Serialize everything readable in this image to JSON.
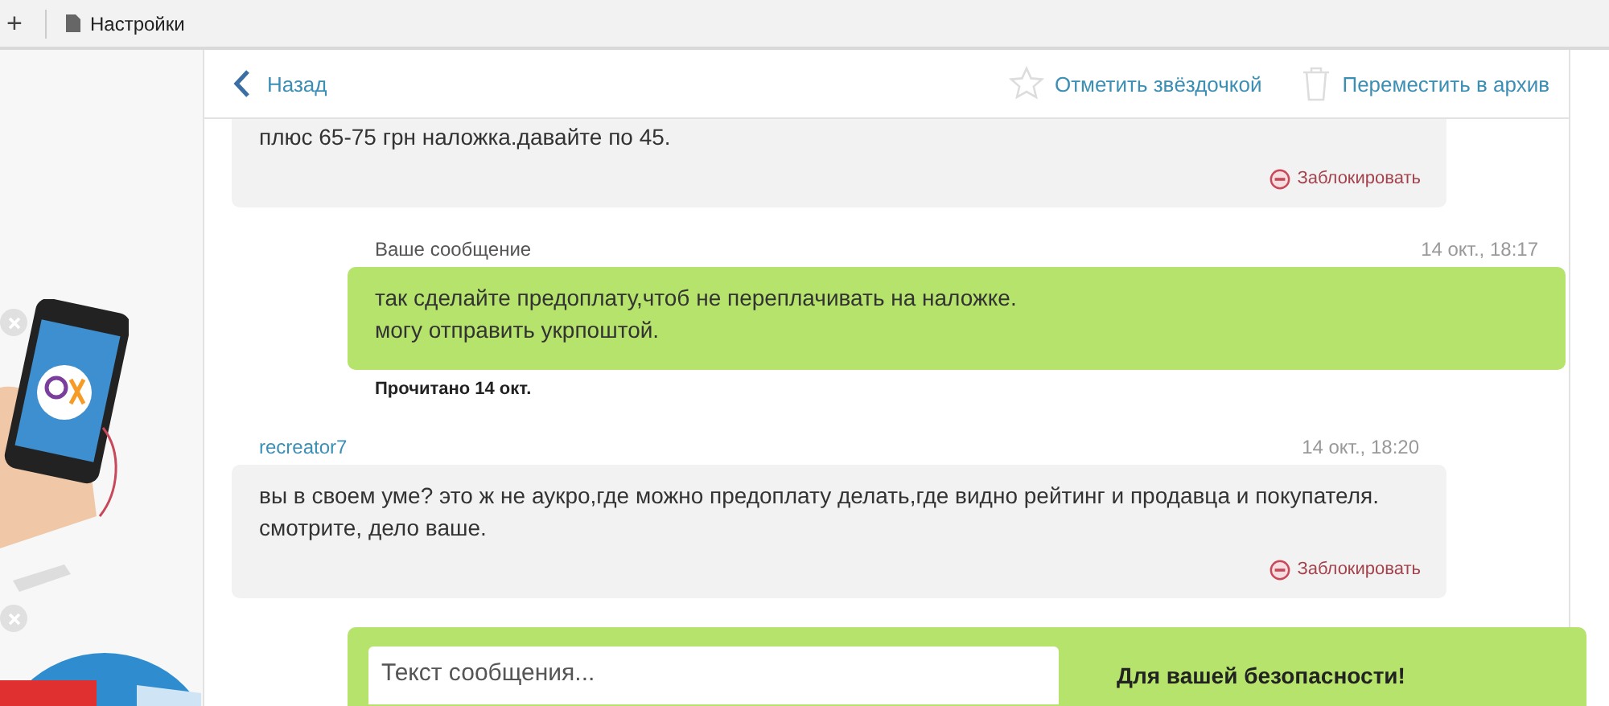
{
  "browser_bar": {
    "new_tab": "+",
    "bookmark": "Настройки"
  },
  "header": {
    "back": "Назад",
    "actions": [
      {
        "kind": "star",
        "label": "Отметить звёздочкой"
      },
      {
        "kind": "archive",
        "label": "Переместить в архив"
      }
    ]
  },
  "messages": [
    {
      "kind": "incoming",
      "lines": [
        "плюс 65-75 грн наложка.давайте по 45."
      ],
      "block": "Заблокировать"
    },
    {
      "kind": "outgoing",
      "author": "Ваше сообщение",
      "time": "14 окт., 18:17",
      "lines": [
        "так сделайте предоплату,чтоб не переплачивать на наложке.",
        "могу отправить укрпоштой."
      ],
      "status": "Прочитано 14 окт."
    },
    {
      "kind": "incoming",
      "author": "recreator7",
      "time": "14 окт., 18:20",
      "lines": [
        "вы в своем уме? это ж не аукро,где можно предоплату делать,где видно рейтинг и продавца и покупателя.",
        "смотрите, дело ваше."
      ],
      "block": "Заблокировать"
    }
  ],
  "compose": {
    "placeholder": "Текст сообщения...",
    "notice_title": "Для вашей безопасности!"
  }
}
